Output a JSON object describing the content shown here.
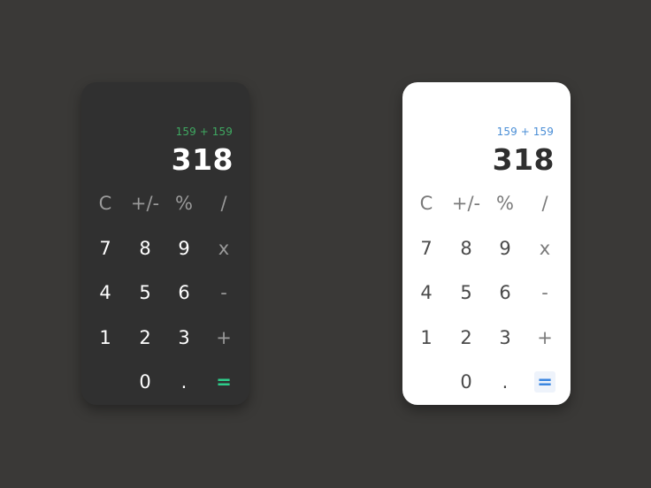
{
  "dark_calculator": {
    "expression": "159 + 159",
    "result": "318",
    "keys": {
      "clear": "C",
      "negate": "+/-",
      "percent": "%",
      "divide": "/",
      "seven": "7",
      "eight": "8",
      "nine": "9",
      "multiply": "x",
      "four": "4",
      "five": "5",
      "six": "6",
      "subtract": "-",
      "one": "1",
      "two": "2",
      "three": "3",
      "add": "+",
      "zero": "0",
      "decimal": ".",
      "equals": "="
    },
    "colors": {
      "background": "#303030",
      "expression": "#3fa861",
      "accent": "#2ecc8a"
    }
  },
  "light_calculator": {
    "expression": "159 + 159",
    "result": "318",
    "keys": {
      "clear": "C",
      "negate": "+/-",
      "percent": "%",
      "divide": "/",
      "seven": "7",
      "eight": "8",
      "nine": "9",
      "multiply": "x",
      "four": "4",
      "five": "5",
      "six": "6",
      "subtract": "-",
      "one": "1",
      "two": "2",
      "three": "3",
      "add": "+",
      "zero": "0",
      "decimal": ".",
      "equals": "="
    },
    "colors": {
      "background": "#ffffff",
      "expression": "#4a8ed6",
      "accent": "#3a86e0"
    }
  }
}
